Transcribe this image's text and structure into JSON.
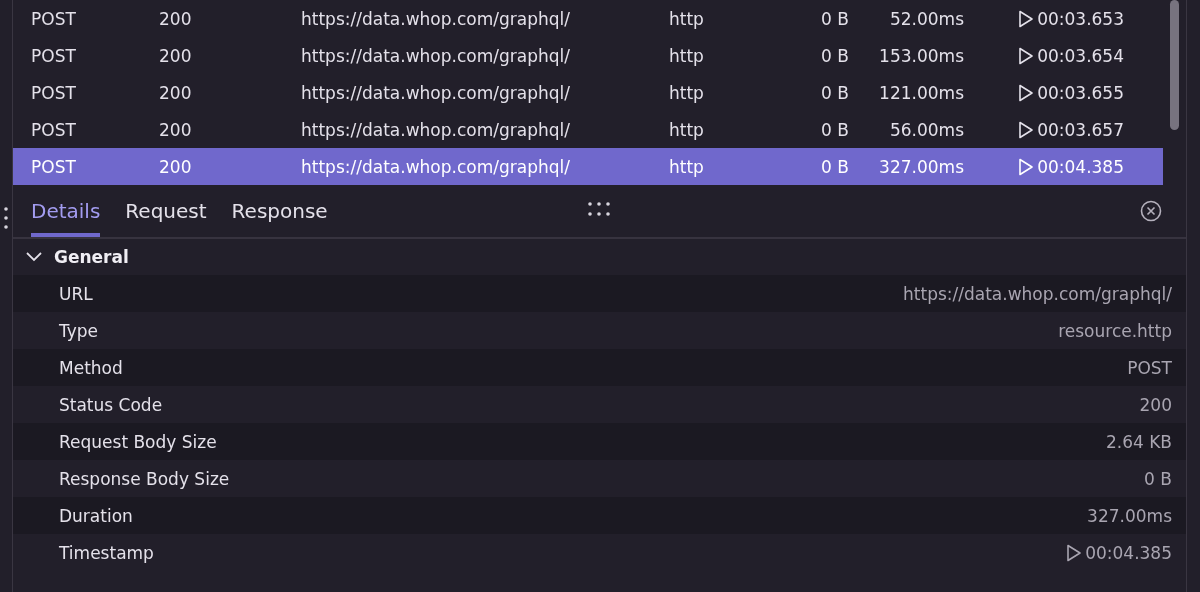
{
  "requests": {
    "rows": [
      {
        "method": "POST",
        "status": "200",
        "url": "https://data.whop.com/graphql/",
        "type": "http",
        "size": "0 B",
        "duration": "52.00ms",
        "timestamp": "00:03.653",
        "selected": false
      },
      {
        "method": "POST",
        "status": "200",
        "url": "https://data.whop.com/graphql/",
        "type": "http",
        "size": "0 B",
        "duration": "153.00ms",
        "timestamp": "00:03.654",
        "selected": false
      },
      {
        "method": "POST",
        "status": "200",
        "url": "https://data.whop.com/graphql/",
        "type": "http",
        "size": "0 B",
        "duration": "121.00ms",
        "timestamp": "00:03.655",
        "selected": false
      },
      {
        "method": "POST",
        "status": "200",
        "url": "https://data.whop.com/graphql/",
        "type": "http",
        "size": "0 B",
        "duration": "56.00ms",
        "timestamp": "00:03.657",
        "selected": false
      },
      {
        "method": "POST",
        "status": "200",
        "url": "https://data.whop.com/graphql/",
        "type": "http",
        "size": "0 B",
        "duration": "327.00ms",
        "timestamp": "00:04.385",
        "selected": true
      }
    ]
  },
  "tabs": [
    {
      "label": "Details",
      "selected": true
    },
    {
      "label": "Request",
      "selected": false
    },
    {
      "label": "Response",
      "selected": false
    }
  ],
  "section": {
    "title": "General",
    "expanded": true,
    "rows": [
      {
        "label": "URL",
        "value": "https://data.whop.com/graphql/",
        "kind": "text"
      },
      {
        "label": "Type",
        "value": "resource.http",
        "kind": "text"
      },
      {
        "label": "Method",
        "value": "POST",
        "kind": "text"
      },
      {
        "label": "Status Code",
        "value": "200",
        "kind": "text"
      },
      {
        "label": "Request Body Size",
        "value": "2.64 KB",
        "kind": "text"
      },
      {
        "label": "Response Body Size",
        "value": "0 B",
        "kind": "text"
      },
      {
        "label": "Duration",
        "value": "327.00ms",
        "kind": "text"
      },
      {
        "label": "Timestamp",
        "value": "00:04.385",
        "kind": "timestamp"
      }
    ]
  }
}
